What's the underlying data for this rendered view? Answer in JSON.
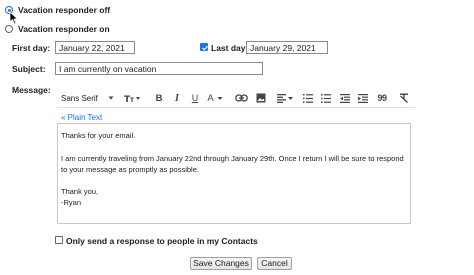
{
  "vacation": {
    "off_label": "Vacation responder off",
    "on_label": "Vacation responder on",
    "selected": "off"
  },
  "first_day": {
    "label": "First day:",
    "value": "January 22, 2021"
  },
  "last_day": {
    "label": "Last day:",
    "value": "January 29, 2021",
    "checked": true
  },
  "subject": {
    "label": "Subject:",
    "value": "I am currently on vacation"
  },
  "message": {
    "label": "Message:"
  },
  "toolbar": {
    "font_name": "Sans Serif",
    "icons": [
      "font-size-icon",
      "bold-icon",
      "italic-icon",
      "underline-icon",
      "text-color-icon",
      "link-icon",
      "image-icon",
      "align-icon",
      "numbered-list-icon",
      "bulleted-list-icon",
      "indent-less-icon",
      "indent-more-icon",
      "quote-icon",
      "remove-formatting-icon"
    ],
    "bold": "B",
    "italic": "I",
    "underline": "U",
    "text_color": "A",
    "quote": "99"
  },
  "plain_text_link": "« Plain Text",
  "body": {
    "greeting": "Thanks for your email.",
    "line1": "I am currently traveling from January 22nd through January 29th. Once I return I will be sure to respond",
    "line2": "to your message as promptly as possible.",
    "closing": "Thank you,",
    "signature": "-Ryan"
  },
  "contacts_only": {
    "label": "Only send a response to people in my Contacts",
    "checked": false
  },
  "buttons": {
    "save": "Save Changes",
    "cancel": "Cancel"
  },
  "colors": {
    "accent": "#1a73e8",
    "text": "#202124",
    "border": "#8a8a8a"
  }
}
